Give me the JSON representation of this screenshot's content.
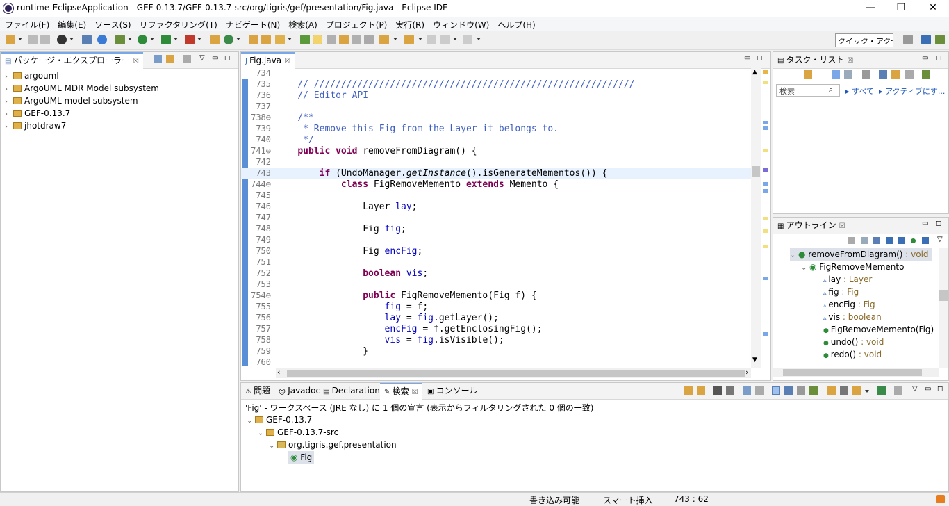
{
  "window": {
    "title": "runtime-EclipseApplication - GEF-0.13.7/GEF-0.13.7-src/org/tigris/gef/presentation/Fig.java - Eclipse IDE",
    "minimize": "—",
    "maximize": "❐",
    "close": "✕"
  },
  "menu": [
    "ファイル(F)",
    "編集(E)",
    "ソース(S)",
    "リファクタリング(T)",
    "ナビゲート(N)",
    "検索(A)",
    "プロジェクト(P)",
    "実行(R)",
    "ウィンドウ(W)",
    "ヘルプ(H)"
  ],
  "toolbar": {
    "quick_access": "クイック・アクセス"
  },
  "package_explorer": {
    "tab": "パッケージ・エクスプローラー",
    "close": "☒",
    "items": [
      "argouml",
      "ArgoUML MDR Model subsystem",
      "ArgoUML model subsystem",
      "GEF-0.13.7",
      "jhotdraw7"
    ]
  },
  "editor": {
    "tab": "Fig.java",
    "close": "☒",
    "lines": [
      {
        "n": "734",
        "html": ""
      },
      {
        "n": "735",
        "html": "    <span class=\"cm\">// ///////////////////////////////////////////////////////////</span>"
      },
      {
        "n": "736",
        "html": "    <span class=\"cm\">// Editor API</span>"
      },
      {
        "n": "737",
        "html": ""
      },
      {
        "n": "738⊖",
        "html": "    <span class=\"cm\">/**</span>"
      },
      {
        "n": "739",
        "html": "    <span class=\"cm\"> * Remove this Fig from the Layer it belongs to.</span>"
      },
      {
        "n": "740",
        "html": "    <span class=\"cm\"> */</span>"
      },
      {
        "n": "741⊖",
        "html": "    <span class=\"kw\">public void</span> removeFromDiagram() {"
      },
      {
        "n": "742",
        "html": ""
      },
      {
        "n": "743",
        "html": "        <span class=\"kw\">if</span> (UndoManager.<span class=\"ita\">getInstance</span>().isGenerateMementos()) {"
      },
      {
        "n": "744⊖",
        "html": "            <span class=\"kw\">class</span> FigRemoveMemento <span class=\"kw\">extends</span> Memento {"
      },
      {
        "n": "745",
        "html": ""
      },
      {
        "n": "746",
        "html": "                Layer <span class=\"fld\">lay</span>;"
      },
      {
        "n": "747",
        "html": ""
      },
      {
        "n": "748",
        "html": "                Fig <span class=\"fld\">fig</span>;"
      },
      {
        "n": "749",
        "html": ""
      },
      {
        "n": "750",
        "html": "                Fig <span class=\"fld\">encFig</span>;"
      },
      {
        "n": "751",
        "html": ""
      },
      {
        "n": "752",
        "html": "                <span class=\"kw\">boolean</span> <span class=\"fld\">vis</span>;"
      },
      {
        "n": "753",
        "html": ""
      },
      {
        "n": "754⊖",
        "html": "                <span class=\"kw\">public</span> FigRemoveMemento(Fig f) {"
      },
      {
        "n": "755",
        "html": "                    <span class=\"fld\">fig</span> = f;"
      },
      {
        "n": "756",
        "html": "                    <span class=\"fld\">lay</span> = <span class=\"fld\">fig</span>.getLayer();"
      },
      {
        "n": "757",
        "html": "                    <span class=\"fld\">encFig</span> = f.getEnclosingFig();"
      },
      {
        "n": "758",
        "html": "                    <span class=\"fld\">vis</span> = <span class=\"fld\">fig</span>.isVisible();"
      },
      {
        "n": "759",
        "html": "                }"
      },
      {
        "n": "760",
        "html": ""
      }
    ]
  },
  "task_list": {
    "tab": "タスク・リスト",
    "close": "☒",
    "search_placeholder": "検索",
    "all": "すべて",
    "active": "アクティブにす..."
  },
  "outline": {
    "tab": "アウトライン",
    "close": "☒",
    "items": [
      {
        "label": "removeFromDiagram()",
        "type": " : void"
      },
      {
        "label": "FigRemoveMemento",
        "type": ""
      },
      {
        "label": "lay",
        "type": " : Layer"
      },
      {
        "label": "fig",
        "type": " : Fig"
      },
      {
        "label": "encFig",
        "type": " : Fig"
      },
      {
        "label": "vis",
        "type": " : boolean"
      },
      {
        "label": "FigRemoveMemento(Fig)",
        "type": ""
      },
      {
        "label": "undo()",
        "type": " : void"
      },
      {
        "label": "redo()",
        "type": " : void"
      }
    ]
  },
  "bottom_tabs": [
    "問題",
    "Javadoc",
    "Declaration",
    "検索",
    "コンソール"
  ],
  "search": {
    "summary": "'Fig' - ワークスペース (JRE なし) に 1 個の宣言 (表示からフィルタリングされた 0 個の一致)",
    "tree": [
      "GEF-0.13.7",
      "GEF-0.13.7-src",
      "org.tigris.gef.presentation",
      "Fig"
    ]
  },
  "status": {
    "writable": "書き込み可能",
    "insert": "スマート挿入",
    "position": "743 : 62"
  }
}
